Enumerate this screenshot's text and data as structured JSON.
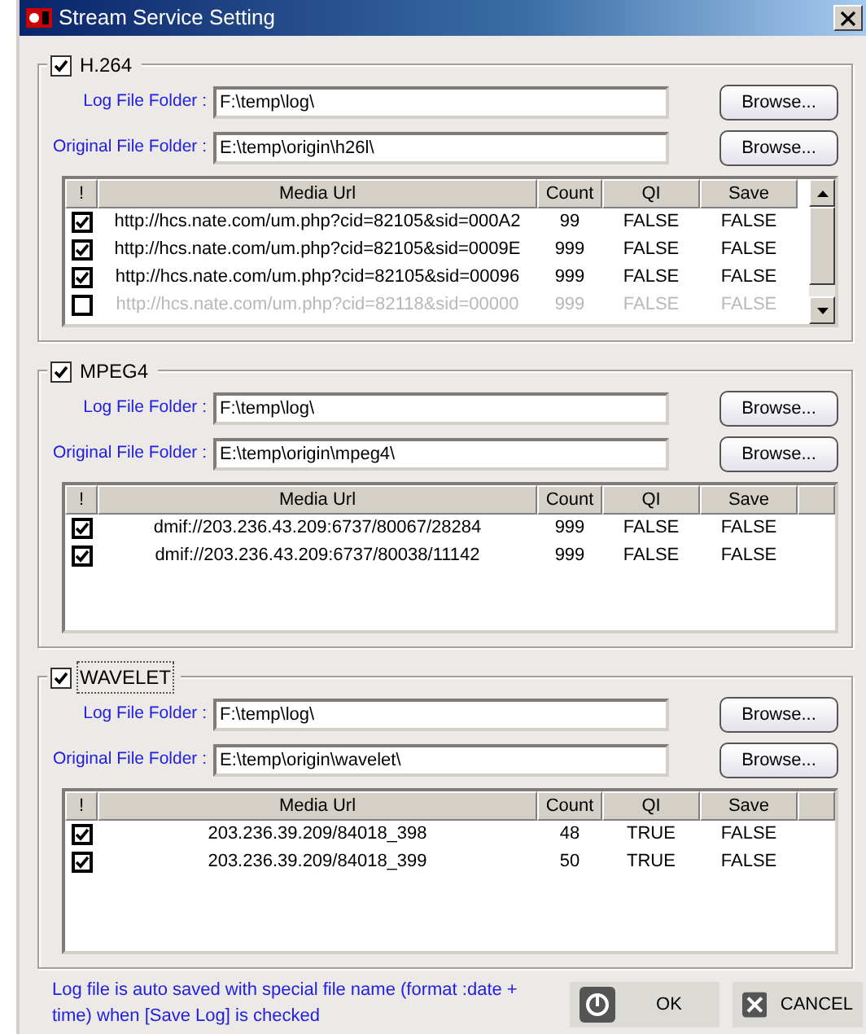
{
  "window": {
    "title": "Stream Service Setting"
  },
  "groups": [
    {
      "label": "H.264",
      "checked": true,
      "focused": false,
      "log_label": "Log File Folder :",
      "log_folder": "F:\\temp\\log\\",
      "log_browse": "Browse...",
      "origin_label": "Original File Folder :",
      "origin_folder": "E:\\temp\\origin\\h26l\\",
      "origin_browse": "Browse...",
      "check_header": "!",
      "columns": [
        "Media Url",
        "Count",
        "QI",
        "Save"
      ],
      "scrollbar": true,
      "rows": [
        {
          "checked": true,
          "disabled": false,
          "cells": [
            "http://hcs.nate.com/um.php?cid=82105&sid=000A2",
            "99",
            "FALSE",
            "FALSE"
          ]
        },
        {
          "checked": true,
          "disabled": false,
          "cells": [
            "http://hcs.nate.com/um.php?cid=82105&sid=0009E",
            "999",
            "FALSE",
            "FALSE"
          ]
        },
        {
          "checked": true,
          "disabled": false,
          "cells": [
            "http://hcs.nate.com/um.php?cid=82105&sid=00096",
            "999",
            "FALSE",
            "FALSE"
          ]
        },
        {
          "checked": false,
          "disabled": true,
          "cells": [
            "http://hcs.nate.com/um.php?cid=82118&sid=00000",
            "999",
            "FALSE",
            "FALSE"
          ]
        }
      ]
    },
    {
      "label": "MPEG4",
      "checked": true,
      "focused": false,
      "log_label": "Log File Folder :",
      "log_folder": "F:\\temp\\log\\",
      "log_browse": "Browse...",
      "origin_label": "Original File Folder :",
      "origin_folder": "E:\\temp\\origin\\mpeg4\\",
      "origin_browse": "Browse...",
      "check_header": "!",
      "columns": [
        "Media Url",
        "Count",
        "QI",
        "Save"
      ],
      "scrollbar": false,
      "rows": [
        {
          "checked": true,
          "disabled": false,
          "cells": [
            "dmif://203.236.43.209:6737/80067/28284",
            "999",
            "FALSE",
            "FALSE"
          ]
        },
        {
          "checked": true,
          "disabled": false,
          "cells": [
            "dmif://203.236.43.209:6737/80038/11142",
            "999",
            "FALSE",
            "FALSE"
          ]
        }
      ]
    },
    {
      "label": "WAVELET",
      "checked": true,
      "focused": true,
      "log_label": "Log File Folder :",
      "log_folder": "F:\\temp\\log\\",
      "log_browse": "Browse...",
      "origin_label": "Original File Folder :",
      "origin_folder": "E:\\temp\\origin\\wavelet\\",
      "origin_browse": "Browse...",
      "check_header": "!",
      "columns": [
        "Media Url",
        "Count",
        "QI",
        "Save"
      ],
      "scrollbar": false,
      "rows": [
        {
          "checked": true,
          "disabled": false,
          "cells": [
            "203.236.39.209/84018_398",
            "48",
            "TRUE",
            "FALSE"
          ]
        },
        {
          "checked": true,
          "disabled": false,
          "cells": [
            "203.236.39.209/84018_399",
            "50",
            "TRUE",
            "FALSE"
          ]
        }
      ]
    }
  ],
  "footer": {
    "note": "Log file is auto saved with special file name (format :date + time) when [Save Log] is checked",
    "buttons": [
      {
        "kind": "ok",
        "label": "OK"
      },
      {
        "kind": "cancel",
        "label": "CANCEL"
      }
    ]
  }
}
